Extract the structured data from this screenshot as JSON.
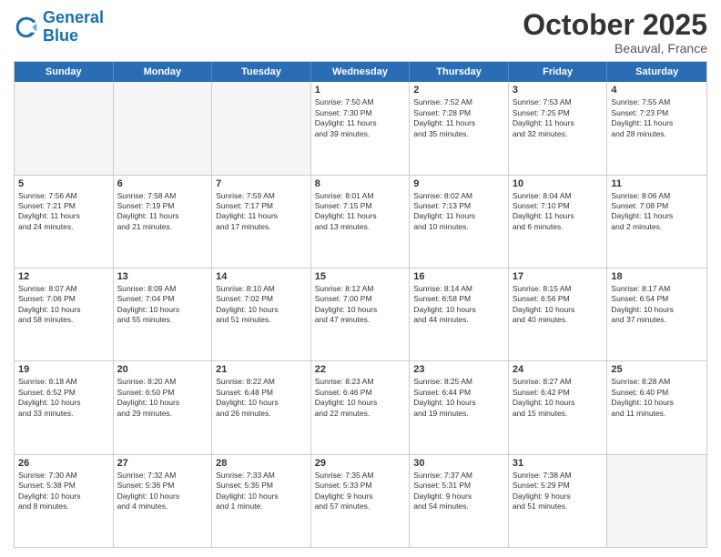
{
  "header": {
    "logo_general": "General",
    "logo_blue": "Blue",
    "month": "October 2025",
    "location": "Beauval, France"
  },
  "days_of_week": [
    "Sunday",
    "Monday",
    "Tuesday",
    "Wednesday",
    "Thursday",
    "Friday",
    "Saturday"
  ],
  "rows": [
    [
      {
        "day": "",
        "text": ""
      },
      {
        "day": "",
        "text": ""
      },
      {
        "day": "",
        "text": ""
      },
      {
        "day": "1",
        "text": "Sunrise: 7:50 AM\nSunset: 7:30 PM\nDaylight: 11 hours\nand 39 minutes."
      },
      {
        "day": "2",
        "text": "Sunrise: 7:52 AM\nSunset: 7:28 PM\nDaylight: 11 hours\nand 35 minutes."
      },
      {
        "day": "3",
        "text": "Sunrise: 7:53 AM\nSunset: 7:25 PM\nDaylight: 11 hours\nand 32 minutes."
      },
      {
        "day": "4",
        "text": "Sunrise: 7:55 AM\nSunset: 7:23 PM\nDaylight: 11 hours\nand 28 minutes."
      }
    ],
    [
      {
        "day": "5",
        "text": "Sunrise: 7:56 AM\nSunset: 7:21 PM\nDaylight: 11 hours\nand 24 minutes."
      },
      {
        "day": "6",
        "text": "Sunrise: 7:58 AM\nSunset: 7:19 PM\nDaylight: 11 hours\nand 21 minutes."
      },
      {
        "day": "7",
        "text": "Sunrise: 7:59 AM\nSunset: 7:17 PM\nDaylight: 11 hours\nand 17 minutes."
      },
      {
        "day": "8",
        "text": "Sunrise: 8:01 AM\nSunset: 7:15 PM\nDaylight: 11 hours\nand 13 minutes."
      },
      {
        "day": "9",
        "text": "Sunrise: 8:02 AM\nSunset: 7:13 PM\nDaylight: 11 hours\nand 10 minutes."
      },
      {
        "day": "10",
        "text": "Sunrise: 8:04 AM\nSunset: 7:10 PM\nDaylight: 11 hours\nand 6 minutes."
      },
      {
        "day": "11",
        "text": "Sunrise: 8:06 AM\nSunset: 7:08 PM\nDaylight: 11 hours\nand 2 minutes."
      }
    ],
    [
      {
        "day": "12",
        "text": "Sunrise: 8:07 AM\nSunset: 7:06 PM\nDaylight: 10 hours\nand 58 minutes."
      },
      {
        "day": "13",
        "text": "Sunrise: 8:09 AM\nSunset: 7:04 PM\nDaylight: 10 hours\nand 55 minutes."
      },
      {
        "day": "14",
        "text": "Sunrise: 8:10 AM\nSunset: 7:02 PM\nDaylight: 10 hours\nand 51 minutes."
      },
      {
        "day": "15",
        "text": "Sunrise: 8:12 AM\nSunset: 7:00 PM\nDaylight: 10 hours\nand 47 minutes."
      },
      {
        "day": "16",
        "text": "Sunrise: 8:14 AM\nSunset: 6:58 PM\nDaylight: 10 hours\nand 44 minutes."
      },
      {
        "day": "17",
        "text": "Sunrise: 8:15 AM\nSunset: 6:56 PM\nDaylight: 10 hours\nand 40 minutes."
      },
      {
        "day": "18",
        "text": "Sunrise: 8:17 AM\nSunset: 6:54 PM\nDaylight: 10 hours\nand 37 minutes."
      }
    ],
    [
      {
        "day": "19",
        "text": "Sunrise: 8:18 AM\nSunset: 6:52 PM\nDaylight: 10 hours\nand 33 minutes."
      },
      {
        "day": "20",
        "text": "Sunrise: 8:20 AM\nSunset: 6:50 PM\nDaylight: 10 hours\nand 29 minutes."
      },
      {
        "day": "21",
        "text": "Sunrise: 8:22 AM\nSunset: 6:48 PM\nDaylight: 10 hours\nand 26 minutes."
      },
      {
        "day": "22",
        "text": "Sunrise: 8:23 AM\nSunset: 6:46 PM\nDaylight: 10 hours\nand 22 minutes."
      },
      {
        "day": "23",
        "text": "Sunrise: 8:25 AM\nSunset: 6:44 PM\nDaylight: 10 hours\nand 19 minutes."
      },
      {
        "day": "24",
        "text": "Sunrise: 8:27 AM\nSunset: 6:42 PM\nDaylight: 10 hours\nand 15 minutes."
      },
      {
        "day": "25",
        "text": "Sunrise: 8:28 AM\nSunset: 6:40 PM\nDaylight: 10 hours\nand 11 minutes."
      }
    ],
    [
      {
        "day": "26",
        "text": "Sunrise: 7:30 AM\nSunset: 5:38 PM\nDaylight: 10 hours\nand 8 minutes."
      },
      {
        "day": "27",
        "text": "Sunrise: 7:32 AM\nSunset: 5:36 PM\nDaylight: 10 hours\nand 4 minutes."
      },
      {
        "day": "28",
        "text": "Sunrise: 7:33 AM\nSunset: 5:35 PM\nDaylight: 10 hours\nand 1 minute."
      },
      {
        "day": "29",
        "text": "Sunrise: 7:35 AM\nSunset: 5:33 PM\nDaylight: 9 hours\nand 57 minutes."
      },
      {
        "day": "30",
        "text": "Sunrise: 7:37 AM\nSunset: 5:31 PM\nDaylight: 9 hours\nand 54 minutes."
      },
      {
        "day": "31",
        "text": "Sunrise: 7:38 AM\nSunset: 5:29 PM\nDaylight: 9 hours\nand 51 minutes."
      },
      {
        "day": "",
        "text": ""
      }
    ]
  ]
}
